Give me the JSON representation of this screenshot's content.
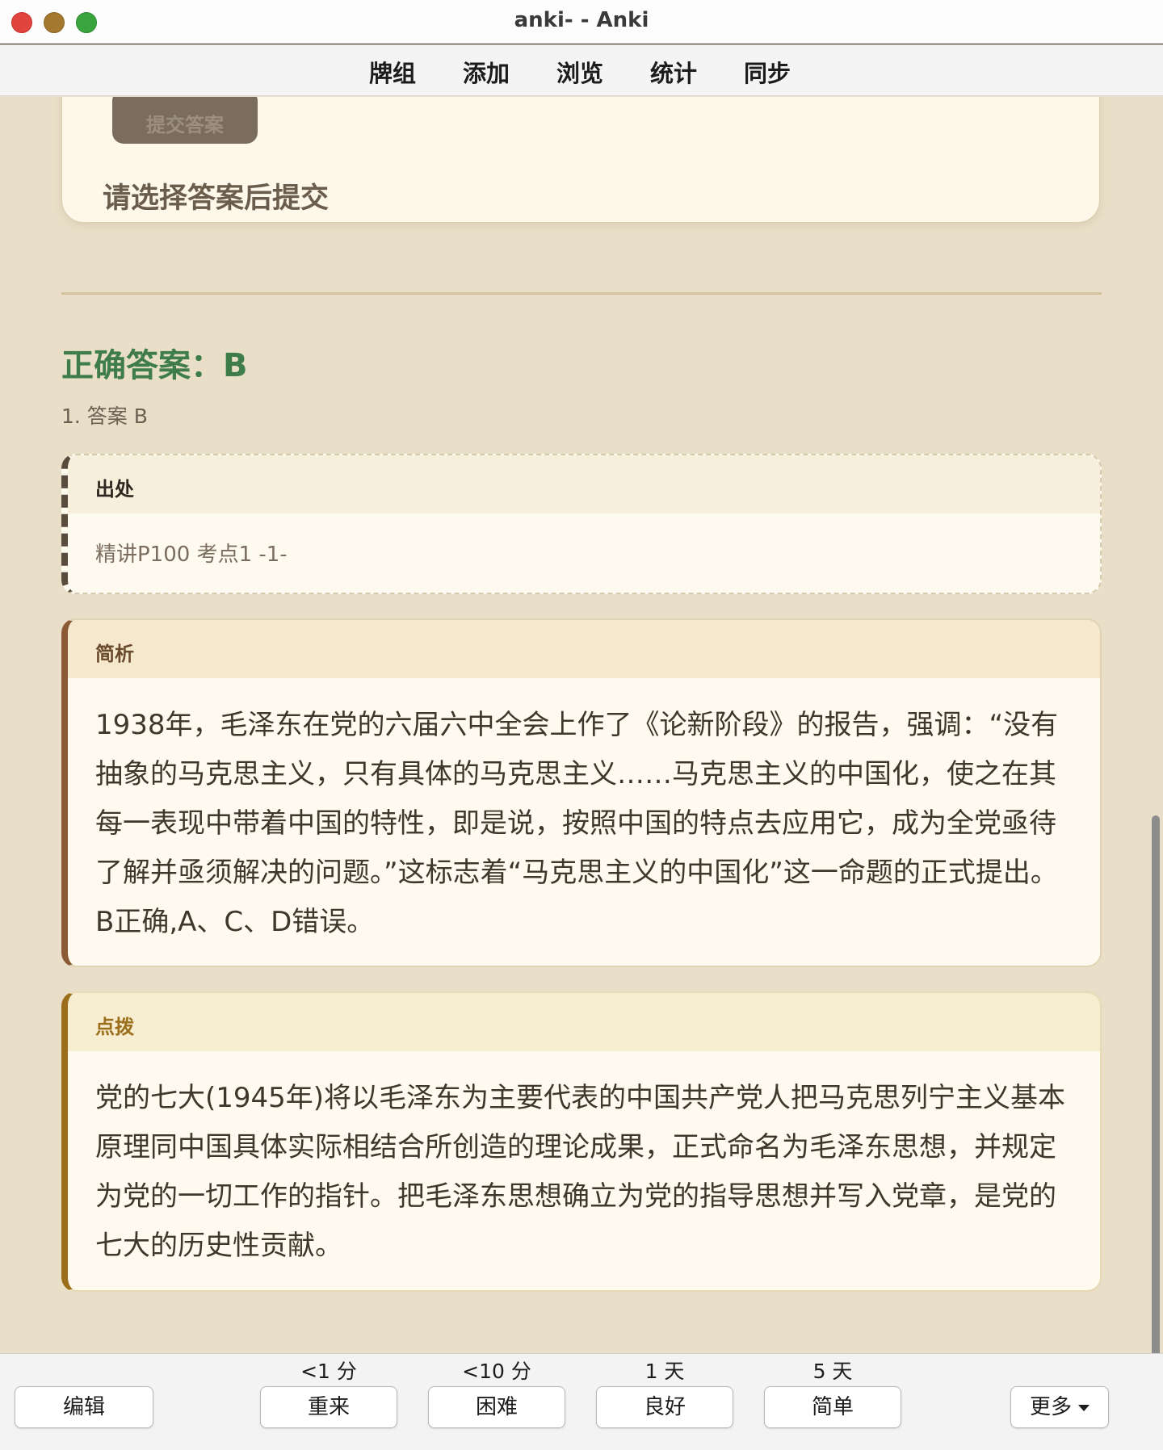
{
  "window": {
    "title": "anki- - Anki"
  },
  "menu": {
    "items": [
      "牌组",
      "添加",
      "浏览",
      "统计",
      "同步"
    ]
  },
  "question": {
    "submit_label": "提交答案",
    "prompt": "请选择答案后提交"
  },
  "answer": {
    "title": "正确答案：B",
    "line": "1. 答案 B"
  },
  "source": {
    "heading": "出处",
    "text": "精讲P100 考点1 -1-"
  },
  "analysis": {
    "heading": "简析",
    "text": "1938年，毛泽东在党的六届六中全会上作了《论新阶段》的报告，强调：“没有抽象的马克思主义，只有具体的马克思主义……马克思主义的中国化，使之在其每一表现中带着中国的特性，即是说，按照中国的特点去应用它，成为全党亟待了解并亟须解决的问题。”这标志着“马克思主义的中国化”这一命题的正式提出。B正确,A、C、D错误。"
  },
  "tip": {
    "heading": "点拨",
    "text": "党的七大(1945年)将以毛泽东为主要代表的中国共产党人把马克思列宁主义基本原理同中国具体实际相结合所创造的理论成果，正式命名为毛泽东思想，并规定为党的一切工作的指针。把毛泽东思想确立为党的指导思想并写入党章，是党的七大的历史性贡献。"
  },
  "bottom": {
    "edit_label": "编辑",
    "more_label": "更多",
    "answers": [
      {
        "interval": "<1 分",
        "label": "重来"
      },
      {
        "interval": "<10 分",
        "label": "困难"
      },
      {
        "interval": "1 天",
        "label": "良好"
      },
      {
        "interval": "5 天",
        "label": "简单"
      }
    ]
  },
  "colors": {
    "background": "#e9dfc8",
    "correct": "#3e7c4a",
    "analysis_accent": "#8a5a34",
    "tip_accent": "#9a6e1a"
  }
}
